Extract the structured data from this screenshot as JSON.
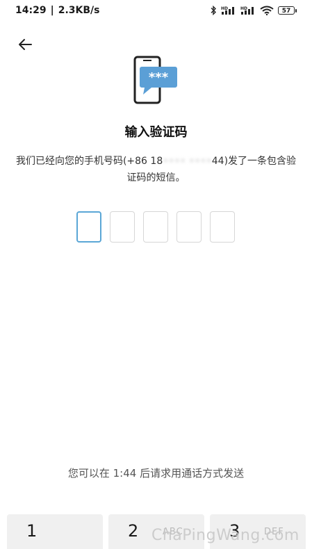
{
  "status_bar": {
    "time": "14:29",
    "speed": "2.3KB/s",
    "battery": "57",
    "icons": [
      "bluetooth-icon",
      "hd-signal-icon",
      "hd-signal-icon",
      "wifi-icon",
      "battery-icon"
    ]
  },
  "header": {
    "back_icon": "back-arrow-icon"
  },
  "hero": {
    "icon": "phone-sms-icon"
  },
  "title": "输入验证码",
  "description": {
    "before": "我们已经向您的手机号码(+86 18",
    "masked": "•••• ••••",
    "after": "44)发了一条包含验证码的短信。"
  },
  "code_input": {
    "length": 5,
    "active_index": 0
  },
  "voice_hint": "您可以在 1:44 后请求用通话方式发送",
  "keypad": {
    "keys": [
      {
        "digit": "1",
        "letters": ""
      },
      {
        "digit": "2",
        "letters": "ABC"
      },
      {
        "digit": "3",
        "letters": "DEF"
      }
    ]
  },
  "watermark": "ChaPingWang.com",
  "colors": {
    "accent": "#5aa6d6",
    "bubble": "#5b9fd6",
    "box_border": "#d6d6d6",
    "key_bg": "#f0f0f0"
  }
}
